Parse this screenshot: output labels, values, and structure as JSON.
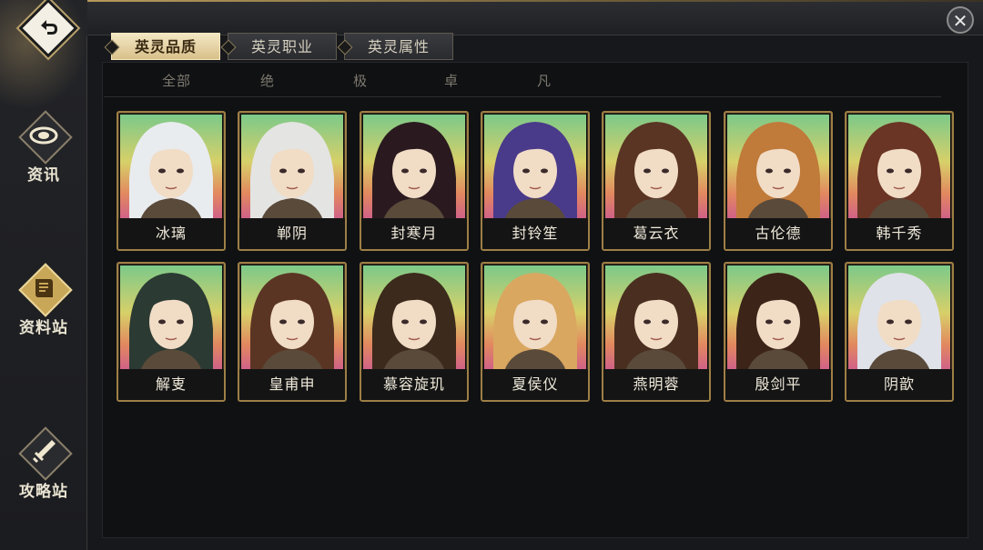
{
  "header": {
    "close_label": "✕"
  },
  "sidebar": {
    "items": [
      {
        "label": "资讯",
        "icon": "scroll-icon",
        "active": false
      },
      {
        "label": "资料站",
        "icon": "book-icon",
        "active": true
      },
      {
        "label": "攻略站",
        "icon": "sword-icon",
        "active": false
      }
    ]
  },
  "tabs": [
    {
      "label": "英灵品质",
      "active": true
    },
    {
      "label": "英灵职业",
      "active": false
    },
    {
      "label": "英灵属性",
      "active": false
    }
  ],
  "subtabs": [
    {
      "label": "全部",
      "active": false
    },
    {
      "label": "绝",
      "active": true
    },
    {
      "label": "极",
      "active": false
    },
    {
      "label": "卓",
      "active": false
    },
    {
      "label": "凡",
      "active": false
    }
  ],
  "heroes": [
    {
      "name": "冰璃",
      "hair": "#e9ecef"
    },
    {
      "name": "郸阴",
      "hair": "#e4e4e2"
    },
    {
      "name": "封寒月",
      "hair": "#2a1a1f"
    },
    {
      "name": "封铃笙",
      "hair": "#4a3a8a"
    },
    {
      "name": "葛云衣",
      "hair": "#5a3524"
    },
    {
      "name": "古伦德",
      "hair": "#c07a3a"
    },
    {
      "name": "韩千秀",
      "hair": "#6a3524"
    },
    {
      "name": "解叓",
      "hair": "#2b3a32"
    },
    {
      "name": "皇甫申",
      "hair": "#5b3524"
    },
    {
      "name": "慕容旋玑",
      "hair": "#3c2a1c"
    },
    {
      "name": "夏侯仪",
      "hair": "#d9a760"
    },
    {
      "name": "燕明蓉",
      "hair": "#4a2f20"
    },
    {
      "name": "殷剑平",
      "hair": "#3c2418"
    },
    {
      "name": "阴歆",
      "hair": "#dfe2e8"
    }
  ],
  "colors": {
    "accent_gold": "#c9a759",
    "card_border": "#9e7f45"
  }
}
